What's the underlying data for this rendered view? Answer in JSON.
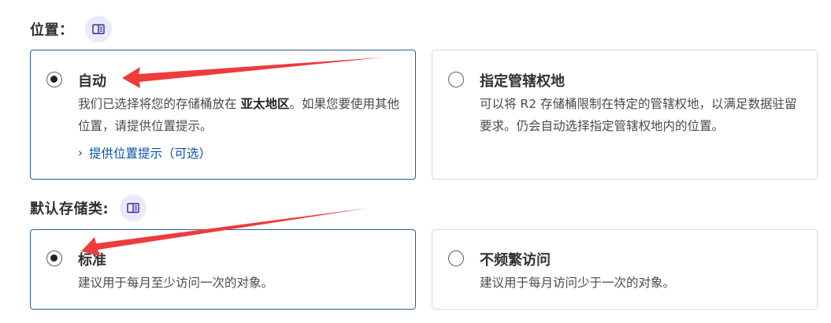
{
  "location": {
    "label": "位置：",
    "doc_icon": "book-icon",
    "options": [
      {
        "title": "自动",
        "selected": true,
        "desc_prefix": "我们已选择将您的存储桶放在 ",
        "desc_bold": "亚太地区",
        "desc_suffix": "。如果您要使用其他位置，请提供位置提示。",
        "link_label": "提供位置提示（可选）"
      },
      {
        "title": "指定管辖权地",
        "selected": false,
        "desc": "可以将 R2 存储桶限制在特定的管辖权地，以满足数据驻留要求。仍会自动选择指定管辖权地内的位置。"
      }
    ]
  },
  "storage_class": {
    "label": "默认存储类:",
    "doc_icon": "book-icon",
    "options": [
      {
        "title": "标准",
        "selected": true,
        "desc": "建议用于每月至少访问一次的对象。"
      },
      {
        "title": "不频繁访问",
        "selected": false,
        "desc": "建议用于每月访问少于一次的对象。"
      }
    ]
  },
  "colors": {
    "arrow": "#ee3b3b",
    "selected_border": "#2f5d94",
    "link": "#0b4fa6"
  }
}
